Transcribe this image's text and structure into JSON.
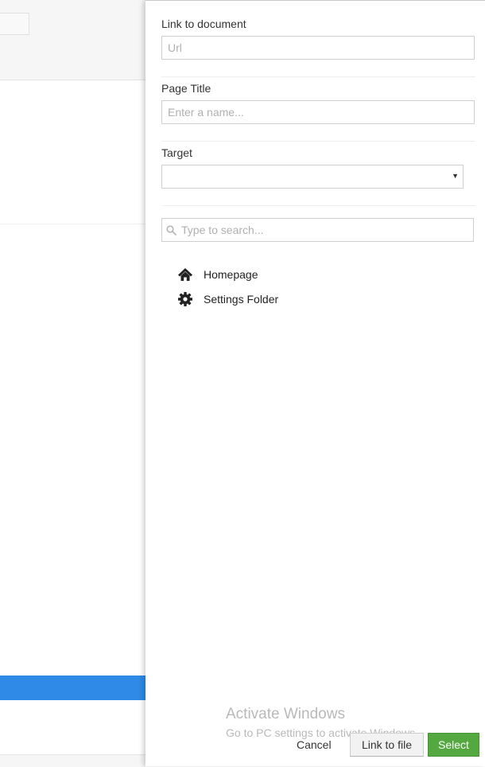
{
  "fields": {
    "link_label": "Link to document",
    "link_placeholder": "Url",
    "link_value": "",
    "title_label": "Page Title",
    "title_placeholder": "Enter a name...",
    "title_value": "",
    "target_label": "Target",
    "target_value": ""
  },
  "search": {
    "placeholder": "Type to search...",
    "value": ""
  },
  "tree": {
    "items": [
      {
        "label": "Homepage",
        "icon": "home-icon"
      },
      {
        "label": "Settings Folder",
        "icon": "gear-icon"
      }
    ]
  },
  "watermark": {
    "title": "Activate Windows",
    "subtitle": "Go to PC settings to activate Windows."
  },
  "footer": {
    "cancel_label": "Cancel",
    "link_file_label": "Link to file",
    "select_label": "Select"
  },
  "colors": {
    "select_button": "#53a93f",
    "selected_row": "#2e8ae6"
  }
}
